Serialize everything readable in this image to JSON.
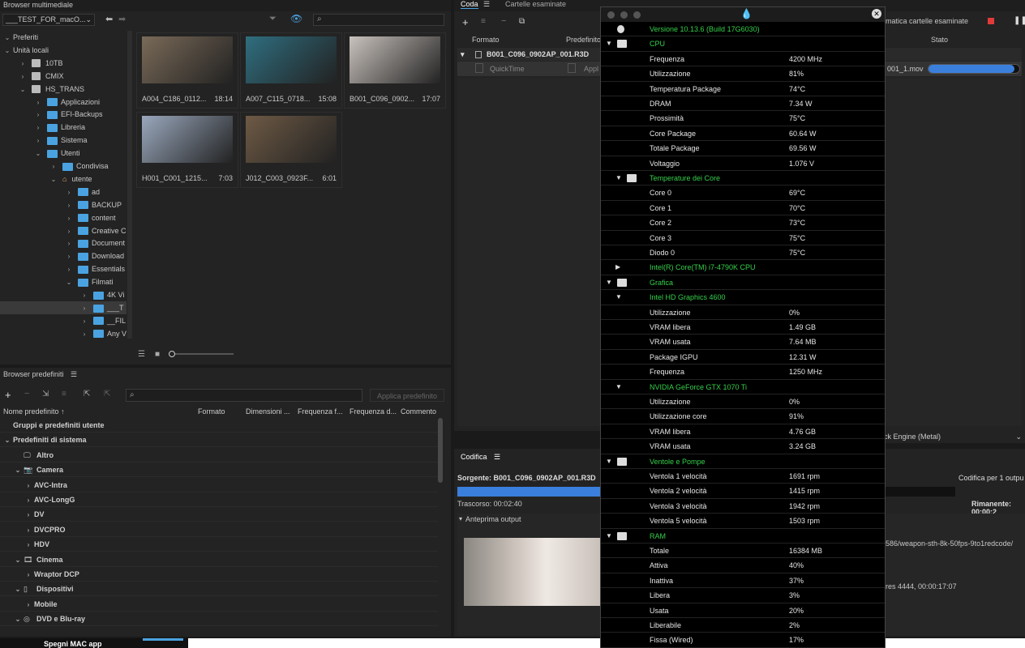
{
  "media_browser": {
    "title": "Browser multimediale",
    "path_dropdown": "___TEST_FOR_macO...",
    "search_placeholder": "",
    "tree": [
      {
        "label": "Preferiti",
        "indent": 0,
        "expanded": true,
        "icon": "none"
      },
      {
        "label": "Unità locali",
        "indent": 0,
        "expanded": true,
        "icon": "none"
      },
      {
        "label": "10TB",
        "indent": 1,
        "expanded": false,
        "icon": "disk-icon"
      },
      {
        "label": "CMIX",
        "indent": 1,
        "expanded": false,
        "icon": "disk-icon"
      },
      {
        "label": "HS_TRANS",
        "indent": 1,
        "expanded": true,
        "icon": "disk-icon"
      },
      {
        "label": "Applicazioni",
        "indent": 2,
        "expanded": false,
        "icon": "folder-icon"
      },
      {
        "label": "EFI-Backups",
        "indent": 2,
        "expanded": false,
        "icon": "folder-icon"
      },
      {
        "label": "Libreria",
        "indent": 2,
        "expanded": false,
        "icon": "folder-icon"
      },
      {
        "label": "Sistema",
        "indent": 2,
        "expanded": false,
        "icon": "folder-icon"
      },
      {
        "label": "Utenti",
        "indent": 2,
        "expanded": true,
        "icon": "folder-icon"
      },
      {
        "label": "Condivisa",
        "indent": 3,
        "expanded": false,
        "icon": "folder-icon"
      },
      {
        "label": "utente",
        "indent": 3,
        "expanded": true,
        "icon": "home-icon"
      },
      {
        "label": "ad",
        "indent": 4,
        "expanded": false,
        "icon": "folder-icon"
      },
      {
        "label": "BACKUP",
        "indent": 4,
        "expanded": false,
        "icon": "folder-icon"
      },
      {
        "label": "content",
        "indent": 4,
        "expanded": false,
        "icon": "folder-icon"
      },
      {
        "label": "Creative C",
        "indent": 4,
        "expanded": false,
        "icon": "folder-icon"
      },
      {
        "label": "Document",
        "indent": 4,
        "expanded": false,
        "icon": "folder-icon"
      },
      {
        "label": "Download",
        "indent": 4,
        "expanded": false,
        "icon": "folder-icon"
      },
      {
        "label": "Essentials",
        "indent": 4,
        "expanded": false,
        "icon": "folder-icon"
      },
      {
        "label": "Filmati",
        "indent": 4,
        "expanded": true,
        "icon": "folder-icon"
      },
      {
        "label": "4K Vi",
        "indent": 5,
        "expanded": false,
        "icon": "folder-icon"
      },
      {
        "label": "___T",
        "indent": 5,
        "expanded": false,
        "icon": "folder-icon"
      },
      {
        "label": "__FIL",
        "indent": 5,
        "expanded": false,
        "icon": "folder-icon"
      },
      {
        "label": "Any V",
        "indent": 5,
        "expanded": false,
        "icon": "folder-icon"
      }
    ],
    "thumbs": [
      {
        "name": "A004_C186_0112...",
        "duration": "18:14",
        "color": "#7a6a58"
      },
      {
        "name": "A007_C115_0718...",
        "duration": "15:08",
        "color": "#2f6e7f"
      },
      {
        "name": "B001_C096_0902...",
        "duration": "17:07",
        "color": "#c9c2bd"
      },
      {
        "name": "H001_C001_1215...",
        "duration": "7:03",
        "color": "#9aa8bd"
      },
      {
        "name": "J012_C003_0923F...",
        "duration": "6:01",
        "color": "#6e5a45"
      }
    ]
  },
  "presets": {
    "title": "Browser predefiniti",
    "apply_button": "Applica predefinito",
    "columns": [
      "Nome predefinito",
      "Formato",
      "Dimensioni ...",
      "Frequenza f...",
      "Frequenza d...",
      "Commento"
    ],
    "rows": [
      {
        "label": "Gruppi e predefiniti utente",
        "indent": 0,
        "chev": "",
        "icon": ""
      },
      {
        "label": "Predefiniti di sistema",
        "indent": 0,
        "chev": "v",
        "icon": ""
      },
      {
        "label": "Altro",
        "indent": 1,
        "chev": "",
        "icon": "monitor-icon"
      },
      {
        "label": "Camera",
        "indent": 1,
        "chev": "v",
        "icon": "camera-icon"
      },
      {
        "label": "AVC-Intra",
        "indent": 2,
        "chev": ">",
        "icon": ""
      },
      {
        "label": "AVC-LongG",
        "indent": 2,
        "chev": ">",
        "icon": ""
      },
      {
        "label": "DV",
        "indent": 2,
        "chev": ">",
        "icon": ""
      },
      {
        "label": "DVCPRO",
        "indent": 2,
        "chev": ">",
        "icon": ""
      },
      {
        "label": "HDV",
        "indent": 2,
        "chev": ">",
        "icon": ""
      },
      {
        "label": "Cinema",
        "indent": 1,
        "chev": "v",
        "icon": "film-icon"
      },
      {
        "label": "Wraptor DCP",
        "indent": 2,
        "chev": ">",
        "icon": ""
      },
      {
        "label": "Dispositivi",
        "indent": 1,
        "chev": "v",
        "icon": "phone-icon"
      },
      {
        "label": "Mobile",
        "indent": 2,
        "chev": ">",
        "icon": ""
      },
      {
        "label": "DVD e Blu-ray",
        "indent": 1,
        "chev": "v",
        "icon": "disc-icon"
      }
    ]
  },
  "queue": {
    "tab_queue": "Coda",
    "tab_watch": "Cartelle esaminate",
    "col_format": "Formato",
    "col_preset": "Predefinito",
    "col_status": "Stato",
    "watch_label": "matica cartelle esaminate",
    "item_name": "B001_C096_0902AP_001.R3D",
    "sub_format": "QuickTime",
    "sub_preset": "Appl",
    "sub_output": "001_1.mov",
    "progress": 0.95,
    "renderer": "ck Engine (Metal)"
  },
  "encoding": {
    "title": "Codifica",
    "source": "Sorgente: B001_C096_0902AP_001.R3D",
    "right_label": "Codifica per 1 outpu",
    "elapsed": "Trascorso: 00:02:40",
    "remaining": "Rimanente: 00:00:2",
    "progress": 0.62,
    "preview_label": "Anteprima output",
    "path": "586/weapon-sth-8k-50fps-9to1redcode/",
    "codec": "res 4444, 00:00:17:07"
  },
  "bottom_banner": "Spegni MAC app",
  "monitor": {
    "rows": [
      {
        "label": "Versione 10.13.6 (Build 17G6030)",
        "value": "",
        "sec": true,
        "tri": "",
        "icon": "apple-icon"
      },
      {
        "label": "CPU",
        "value": "",
        "sec": true,
        "tri": "▼",
        "icon": "cpu-icon"
      },
      {
        "label": "Frequenza",
        "value": "4200 MHz"
      },
      {
        "label": "Utilizzazione",
        "value": "81%"
      },
      {
        "label": "Temperatura Package",
        "value": "74°C"
      },
      {
        "label": "DRAM",
        "value": "7.34 W"
      },
      {
        "label": "Prossimità",
        "value": "75°C"
      },
      {
        "label": "Core Package",
        "value": "60.64 W"
      },
      {
        "label": "Totale Package",
        "value": "69.56 W"
      },
      {
        "label": "Voltaggio",
        "value": "1.076 V"
      },
      {
        "label": "Temperature dei Core",
        "value": "",
        "sec": true,
        "tri": "▼",
        "icon": "thermometer-icon",
        "sub": true
      },
      {
        "label": "Core 0",
        "value": "69°C"
      },
      {
        "label": "Core 1",
        "value": "70°C"
      },
      {
        "label": "Core 2",
        "value": "73°C"
      },
      {
        "label": "Core 3",
        "value": "75°C"
      },
      {
        "label": "Diodo 0",
        "value": "75°C"
      },
      {
        "label": "Intel(R) Core(TM) i7-4790K CPU",
        "value": "",
        "sec": true,
        "tri": "▶",
        "sub": true
      },
      {
        "label": "Grafica",
        "value": "",
        "sec": true,
        "tri": "▼",
        "icon": "gpu-icon"
      },
      {
        "label": "Intel HD Graphics 4600",
        "value": "",
        "sec": true,
        "tri": "▼",
        "sub": true
      },
      {
        "label": "Utilizzazione",
        "value": "0%"
      },
      {
        "label": "VRAM libera",
        "value": "1.49 GB"
      },
      {
        "label": "VRAM usata",
        "value": "7.64 MB"
      },
      {
        "label": "Package IGPU",
        "value": "12.31 W"
      },
      {
        "label": "Frequenza",
        "value": "1250 MHz"
      },
      {
        "label": "NVIDIA GeForce GTX 1070 Ti",
        "value": "",
        "sec": true,
        "tri": "▼",
        "sub": true
      },
      {
        "label": "Utilizzazione",
        "value": "0%"
      },
      {
        "label": "Utilizzazione core",
        "value": "91%"
      },
      {
        "label": "VRAM libera",
        "value": "4.76 GB"
      },
      {
        "label": "VRAM usata",
        "value": "3.24 GB"
      },
      {
        "label": "Ventole e Pompe",
        "value": "",
        "sec": true,
        "tri": "▼",
        "icon": "fan-icon"
      },
      {
        "label": "Ventola 1 velocità",
        "value": "1691 rpm"
      },
      {
        "label": "Ventola 2 velocità",
        "value": "1415 rpm"
      },
      {
        "label": "Ventola 3 velocità",
        "value": "1942 rpm"
      },
      {
        "label": "Ventola 5 velocità",
        "value": "1503 rpm"
      },
      {
        "label": "RAM",
        "value": "",
        "sec": true,
        "tri": "▼",
        "icon": "ram-icon"
      },
      {
        "label": "Totale",
        "value": "16384 MB"
      },
      {
        "label": "Attiva",
        "value": "40%"
      },
      {
        "label": "Inattiva",
        "value": "37%"
      },
      {
        "label": "Libera",
        "value": "3%"
      },
      {
        "label": "Usata",
        "value": "20%"
      },
      {
        "label": "Liberabile",
        "value": "2%"
      },
      {
        "label": "Fissa (Wired)",
        "value": "17%"
      }
    ]
  }
}
